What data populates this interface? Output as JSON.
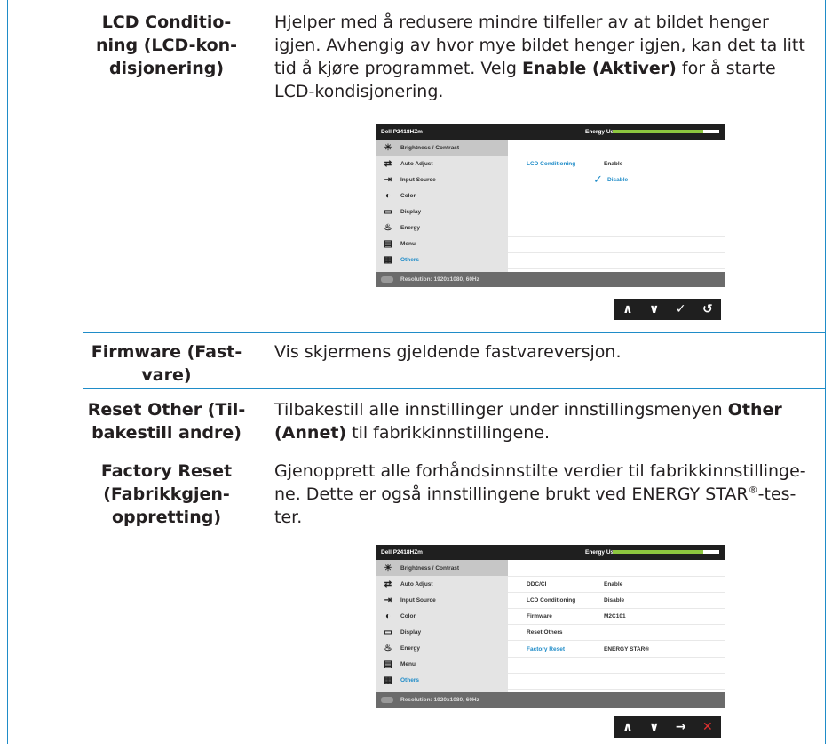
{
  "rows": [
    {
      "term": [
        "LCD Conditio-",
        "ning (LCD-kon-",
        "disjonering)"
      ],
      "desc_html": "Hjelper med å redusere mindre tilfeller av at bildet henger igjen. Avhengig av hvor mye bildet henger igjen, kan det ta litt tid å kjøre programmet. Velg <b>Enable (Aktiver)</b> for å starte LCD-kondisjonering."
    },
    {
      "term": [
        "Firmware (Fast-",
        "vare)"
      ],
      "desc_html": "Vis skjermens gjeldende fastvareversjon."
    },
    {
      "term": [
        "Reset Other (Til-",
        "bakestill andre)"
      ],
      "desc_html": "Tilbakestill alle innstillinger under innstillingsmenyen <b>Other (Annet)</b> til fabrikkinnstillingene."
    },
    {
      "term": [
        "Factory Reset",
        "(Fabrikkgjen-",
        "oppretting)"
      ],
      "desc_html": "Gjenopprett alle forhåndsinnstilte verdier til fabrikkinnstillinge-ne. Dette er også innstillingene brukt ved ENERGY STAR<sup>®</sup>-tes-ter."
    }
  ],
  "osd": {
    "model": "Dell P2418HZm",
    "energy_label": "Energy Use",
    "energy_level_fraction": 0.85,
    "resolution": "Resolution: 1920x1080, 60Hz",
    "menu": [
      {
        "label": "Brightness / Contrast",
        "icon": "brightness-icon"
      },
      {
        "label": "Auto Adjust",
        "icon": "auto-adjust-icon"
      },
      {
        "label": "Input Source",
        "icon": "input-source-icon"
      },
      {
        "label": "Color",
        "icon": "color-icon"
      },
      {
        "label": "Display",
        "icon": "display-icon"
      },
      {
        "label": "Energy",
        "icon": "energy-icon"
      },
      {
        "label": "Menu",
        "icon": "menu-icon"
      },
      {
        "label": "Others",
        "icon": "others-icon"
      }
    ],
    "screen1": {
      "items": [
        {
          "label": "LCD Conditioning",
          "value": "Enable"
        },
        {
          "label": "",
          "value": "Disable",
          "checked": true
        }
      ],
      "buttons": [
        "∧",
        "∨",
        "✓",
        "↺"
      ]
    },
    "screen2": {
      "items": [
        {
          "label": "DDC/CI",
          "value": "Enable"
        },
        {
          "label": "LCD Conditioning",
          "value": "Disable"
        },
        {
          "label": "Firmware",
          "value": "M2C101"
        },
        {
          "label": "Reset Others",
          "value": ""
        },
        {
          "label": "Factory Reset",
          "value": "ENERGY STAR®"
        }
      ],
      "buttons": [
        "∧",
        "∨",
        "→",
        "✕"
      ]
    }
  }
}
